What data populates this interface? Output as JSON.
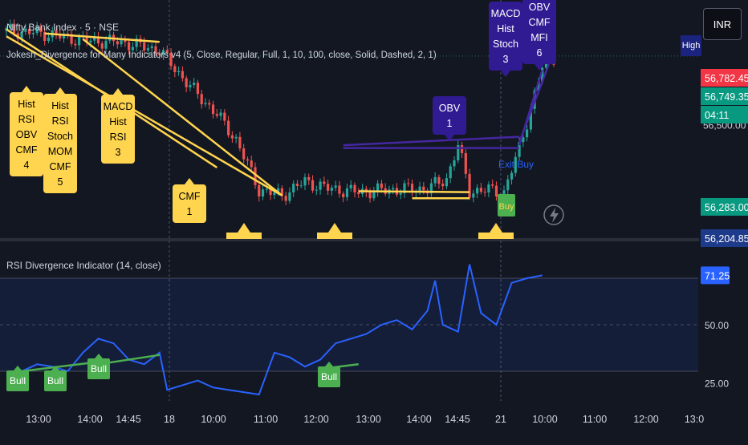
{
  "header": {
    "symbol_title": "Nifty Bank Index · 5 · NSE",
    "indicator1_title": "Jokesh_Divergence for Many Indicators v4 (5, Close, Regular, Full, 1, 10, 100, close, Solid, Dashed, 2, 1)",
    "indicator2_title": "RSI Divergence Indicator (14, close)",
    "currency_button": "INR",
    "high_tag": "High"
  },
  "colors": {
    "background": "#131722",
    "up_candle": "#26a69a",
    "down_candle": "#ef5350",
    "bull_divergence": "#ffd54f",
    "bear_divergence": "#311b92",
    "rsi_line": "#2962ff",
    "rsi_bull_label": "#4caf50",
    "price_red_tag": "#f23645",
    "price_green_tag": "#089981"
  },
  "price_axis": {
    "tick_labels": [
      "56,500.00"
    ],
    "tags": [
      {
        "text": "56,782.45",
        "kind": "red"
      },
      {
        "text": "56,749.35",
        "kind": "green"
      },
      {
        "text": "04:11",
        "kind": "green"
      },
      {
        "text": "56,283.00",
        "kind": "green"
      },
      {
        "text": "56,204.85",
        "kind": "dark"
      }
    ]
  },
  "time_axis": {
    "labels": [
      "13:00",
      "14:00",
      "14:45",
      "18",
      "10:00",
      "11:00",
      "12:00",
      "13:00",
      "14:00",
      "14:45",
      "21",
      "10:00",
      "11:00",
      "12:00",
      "13:0"
    ]
  },
  "price_labels": {
    "bull": [
      {
        "lines": [
          "Hist",
          "RSI",
          "OBV",
          "CMF",
          "4"
        ]
      },
      {
        "lines": [
          "Hist",
          "RSI",
          "Stoch",
          "MOM",
          "CMF",
          "5"
        ]
      },
      {
        "lines": [
          "MACD",
          "Hist",
          "RSI",
          "3"
        ]
      },
      {
        "lines": [
          "CMF",
          "1"
        ]
      }
    ],
    "bear": [
      {
        "lines": [
          "OBV",
          "1"
        ]
      },
      {
        "lines": [
          "MACD",
          "Hist",
          "Stoch",
          "3"
        ]
      },
      {
        "lines": [
          "OBV",
          "CMF",
          "MFI",
          "6"
        ]
      }
    ],
    "signals": {
      "exit_buy": "Exit Buy",
      "buy": "Buy"
    }
  },
  "chart_data": [
    {
      "type": "candlestick",
      "title": "Nifty Bank Index · 5 · NSE",
      "ylim": [
        56100,
        56950
      ],
      "y_ticks": [
        56500
      ],
      "last_close": 56749.35,
      "high_marker": 56782.45,
      "close_path_points": [
        [
          0,
          56840
        ],
        [
          10,
          56830
        ],
        [
          20,
          56805
        ],
        [
          30,
          56800
        ],
        [
          40,
          56770
        ],
        [
          48,
          56640
        ],
        [
          55,
          56540
        ],
        [
          60,
          56450
        ],
        [
          66,
          56270
        ],
        [
          72,
          56250
        ],
        [
          78,
          56300
        ],
        [
          84,
          56275
        ],
        [
          92,
          56262
        ],
        [
          100,
          56270
        ],
        [
          110,
          56275
        ],
        [
          115,
          56310
        ],
        [
          118,
          56430
        ],
        [
          121,
          56265
        ],
        [
          126,
          56270
        ],
        [
          130,
          56260
        ],
        [
          134,
          56420
        ],
        [
          137,
          56560
        ],
        [
          140,
          56710
        ],
        [
          143,
          56745
        ]
      ]
    },
    {
      "type": "line",
      "title": "RSI Divergence Indicator (14, close)",
      "ylim": [
        20,
        80
      ],
      "y_ticks": [
        25,
        50,
        71.25
      ],
      "last_value": 71.25,
      "overbought": 70,
      "oversold": 30,
      "bull_labels": [
        "Bull",
        "Bull",
        "Bull",
        "Bull"
      ],
      "points": [
        [
          0,
          29
        ],
        [
          4,
          30
        ],
        [
          8,
          33
        ],
        [
          12,
          32
        ],
        [
          16,
          30
        ],
        [
          20,
          38
        ],
        [
          24,
          44
        ],
        [
          28,
          42
        ],
        [
          32,
          35
        ],
        [
          36,
          33
        ],
        [
          40,
          38
        ],
        [
          42,
          22
        ],
        [
          46,
          24
        ],
        [
          50,
          26
        ],
        [
          54,
          23
        ],
        [
          58,
          22
        ],
        [
          62,
          21
        ],
        [
          66,
          20
        ],
        [
          70,
          38
        ],
        [
          74,
          36
        ],
        [
          78,
          32
        ],
        [
          82,
          35
        ],
        [
          86,
          42
        ],
        [
          90,
          44
        ],
        [
          94,
          46
        ],
        [
          98,
          50
        ],
        [
          102,
          52
        ],
        [
          106,
          48
        ],
        [
          110,
          56
        ],
        [
          112,
          69
        ],
        [
          114,
          50
        ],
        [
          118,
          47
        ],
        [
          121,
          76
        ],
        [
          124,
          55
        ],
        [
          128,
          50
        ],
        [
          132,
          68
        ],
        [
          136,
          70
        ],
        [
          140,
          71.25
        ]
      ]
    }
  ]
}
